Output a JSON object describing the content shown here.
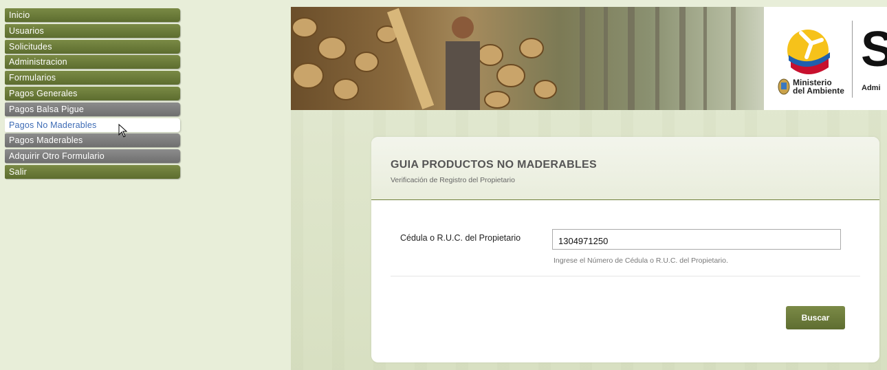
{
  "sidebar": {
    "items": [
      {
        "label": "Inicio",
        "style": "green"
      },
      {
        "label": "Usuarios",
        "style": "green"
      },
      {
        "label": "Solicitudes",
        "style": "green"
      },
      {
        "label": "Administracion",
        "style": "green"
      },
      {
        "label": "Formularios",
        "style": "green"
      },
      {
        "label": "Pagos Generales",
        "style": "green"
      },
      {
        "label": "Pagos Balsa Pigue",
        "style": "gray"
      },
      {
        "label": "Pagos No Maderables",
        "style": "active"
      },
      {
        "label": "Pagos Maderables",
        "style": "gray"
      },
      {
        "label": "Adquirir Otro Formulario",
        "style": "gray"
      },
      {
        "label": "Salir",
        "style": "green"
      }
    ]
  },
  "banner": {
    "ministry_line1": "Ministerio",
    "ministry_line2": "del Ambiente",
    "partner_letter": "S",
    "partner_text": "Admi"
  },
  "form": {
    "title": "GUIA PRODUCTOS NO MADERABLES",
    "subtitle": "Verificación de Registro del Propietario",
    "field_label": "Cédula o R.U.C. del Propietario",
    "field_value": "1304971250",
    "field_help": "Ingrese el Número de Cédula o R.U.C. del Propietario.",
    "submit_label": "Buscar"
  },
  "colors": {
    "nav_green": "#6b7b3a",
    "nav_gray": "#7d7d7d",
    "nav_active_text": "#3d6bb5",
    "accent_line": "#6e7e38",
    "page_bg": "#e8eed9"
  }
}
